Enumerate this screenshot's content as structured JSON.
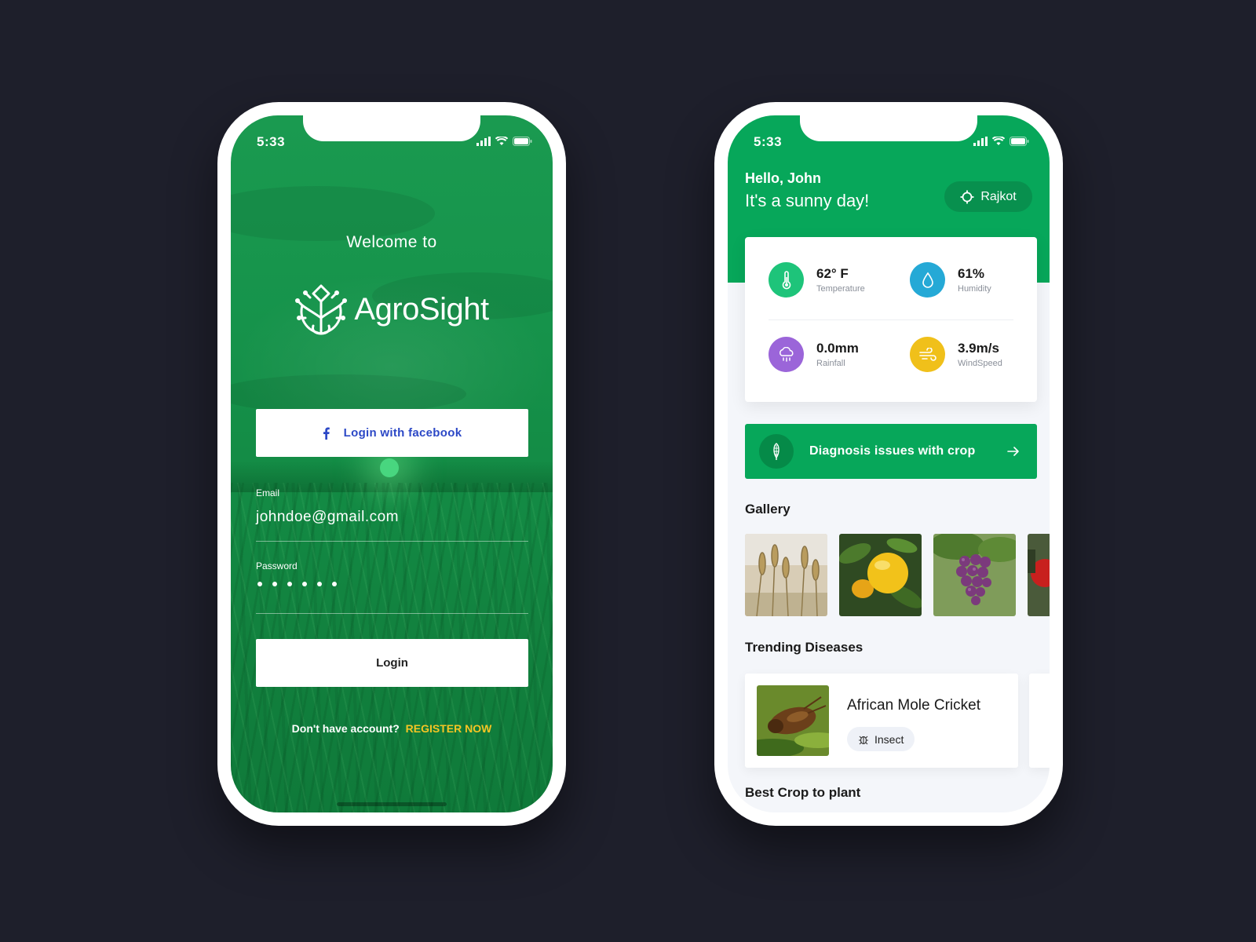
{
  "left": {
    "status": {
      "time": "5:33"
    },
    "welcome": "Welcome to",
    "logo_text": "AgroSight",
    "fb_button": "Login with facebook",
    "email": {
      "label": "Email",
      "value": "johndoe@gmail.com"
    },
    "password": {
      "label": "Password",
      "dots": 6
    },
    "login_button": "Login",
    "register": {
      "prompt": "Don't have account?",
      "link": "REGISTER NOW"
    }
  },
  "right": {
    "status": {
      "time": "5:33"
    },
    "greeting": "Hello, John",
    "subgreeting": "It's a sunny day!",
    "location": "Rajkot",
    "weather": [
      {
        "value": "62° F",
        "label": "Temperature",
        "icon": "thermometer-icon",
        "color": "#1ec47a"
      },
      {
        "value": "61%",
        "label": "Humidity",
        "icon": "droplet-icon",
        "color": "#25a9d6"
      },
      {
        "value": "0.0mm",
        "label": "Rainfall",
        "icon": "rain-cloud-icon",
        "color": "#9b65d9"
      },
      {
        "value": "3.9m/s",
        "label": "WindSpeed",
        "icon": "wind-icon",
        "color": "#f0c01a"
      }
    ],
    "diagnosis_button": "Diagnosis issues with crop",
    "gallery_title": "Gallery",
    "gallery": [
      "wheat",
      "lemon",
      "grapes",
      "tomato"
    ],
    "trending_title": "Trending Diseases",
    "disease": {
      "name": "African Mole Cricket",
      "tag": "Insect"
    },
    "best_title": "Best Crop to plant"
  },
  "colors": {
    "brand_green": "#07a75a",
    "accent_yellow": "#f5c524",
    "background": "#1e1f2b"
  }
}
